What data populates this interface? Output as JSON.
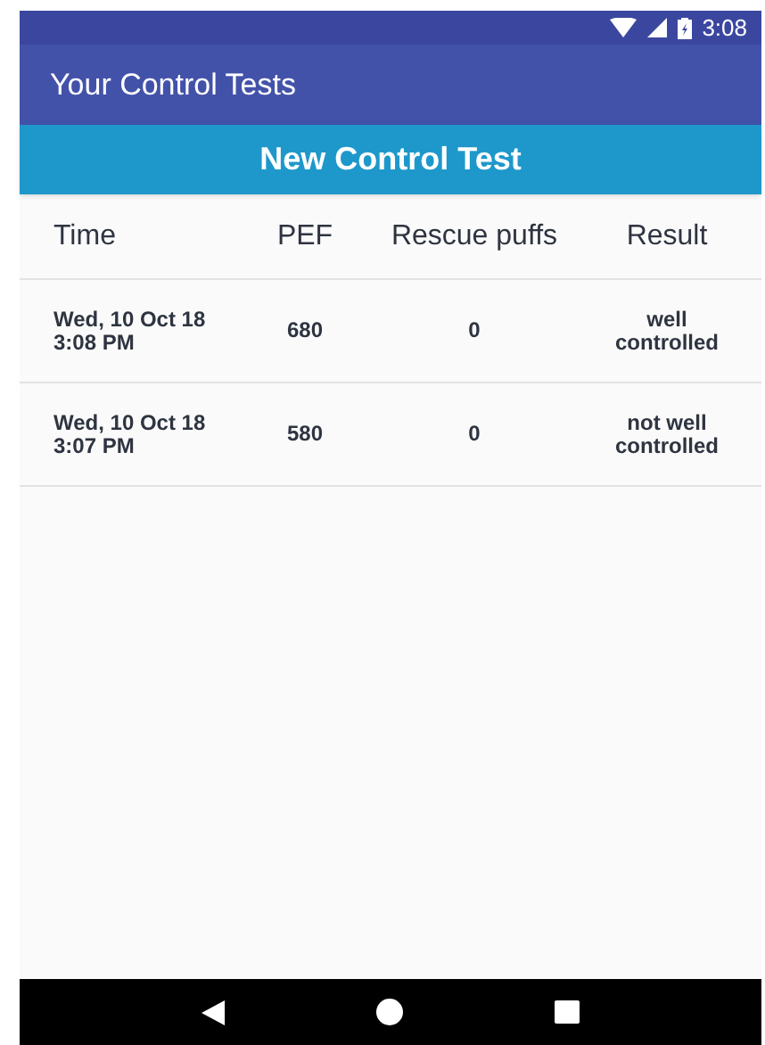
{
  "status_bar": {
    "time": "3:08"
  },
  "app_bar": {
    "title": "Your Control Tests"
  },
  "new_test_button": {
    "label": "New Control Test"
  },
  "table": {
    "columns": [
      "Time",
      "PEF",
      "Rescue puffs",
      "Result"
    ],
    "rows": [
      {
        "time": [
          "Wed, 10 Oct 18",
          "3:08 PM"
        ],
        "pef": "680",
        "rescue_puffs": "0",
        "result": [
          "well",
          "controlled"
        ]
      },
      {
        "time": [
          "Wed, 10 Oct 18",
          "3:07 PM"
        ],
        "pef": "580",
        "rescue_puffs": "0",
        "result": [
          "not well",
          "controlled"
        ]
      }
    ]
  }
}
